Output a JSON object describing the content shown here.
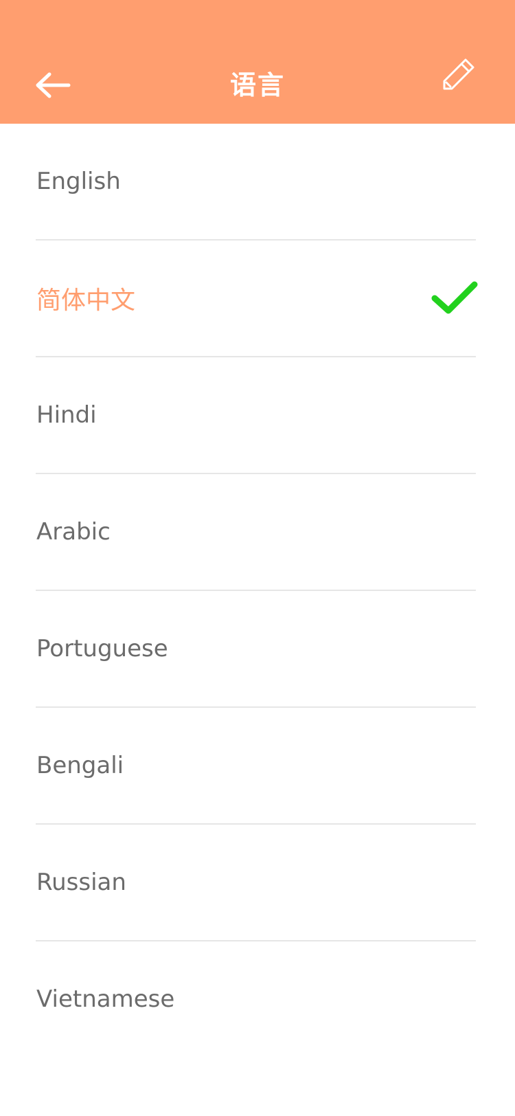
{
  "header": {
    "title": "语言",
    "back_icon": "arrow-left-icon",
    "edit_icon": "pencil-icon",
    "color": "#FF9E6F"
  },
  "languages": [
    {
      "label": "English",
      "selected": false
    },
    {
      "label": "简体中文",
      "selected": true
    },
    {
      "label": "Hindi",
      "selected": false
    },
    {
      "label": "Arabic",
      "selected": false
    },
    {
      "label": "Portuguese",
      "selected": false
    },
    {
      "label": "Bengali",
      "selected": false
    },
    {
      "label": "Russian",
      "selected": false
    },
    {
      "label": "Vietnamese",
      "selected": false
    }
  ],
  "colors": {
    "accent": "#FF9E6F",
    "check": "#22D11E",
    "text": "#6b6b6b",
    "divider": "#e6e6e6"
  }
}
